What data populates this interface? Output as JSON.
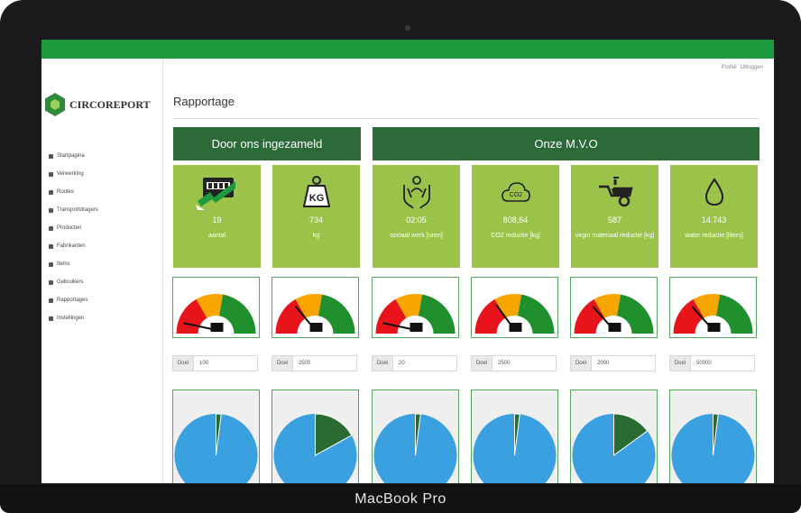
{
  "laptop": {
    "brand": "MacBook Pro"
  },
  "topbar": {
    "links": [
      "Profiel",
      "Uitloggen"
    ]
  },
  "sidebar": {
    "logo_text": "CIRCOREPORT",
    "items": [
      {
        "label": "Startpagina",
        "icon": "home-icon"
      },
      {
        "label": "Verwerking",
        "icon": "grid-icon"
      },
      {
        "label": "Routes",
        "icon": "route-icon"
      },
      {
        "label": "Transportdragers",
        "icon": "truck-icon"
      },
      {
        "label": "Producten",
        "icon": "box-icon"
      },
      {
        "label": "Fabrikanten",
        "icon": "factory-icon"
      },
      {
        "label": "Items",
        "icon": "list-icon"
      },
      {
        "label": "Gebruikers",
        "icon": "users-icon"
      },
      {
        "label": "Rapportages",
        "icon": "report-icon"
      },
      {
        "label": "Instellingen",
        "icon": "settings-icon"
      }
    ]
  },
  "page": {
    "title": "Rapportage"
  },
  "sections": {
    "collected": "Door ons ingezameld",
    "mvo": "Onze M.V.O"
  },
  "tiles": [
    {
      "value": "19",
      "label": "aantal",
      "icon": "container-icon",
      "gauge_pct": 10,
      "goal": "100",
      "pie_pct": 2
    },
    {
      "value": "734",
      "label": "kg",
      "icon": "weight-kg-icon",
      "gauge_pct": 30,
      "goal": "2500",
      "pie_pct": 17
    },
    {
      "value": "02:05",
      "label": "sociaal werk [uren]",
      "icon": "hands-person-icon",
      "gauge_pct": 10,
      "goal": "20",
      "pie_pct": 2
    },
    {
      "value": "808,64",
      "label": "CO2 reductie [kg]",
      "icon": "co2-cloud-icon",
      "gauge_pct": 32,
      "goal": "2500",
      "pie_pct": 2
    },
    {
      "value": "587",
      "label": "virgin materiaal reductie [kg]",
      "icon": "wheelbarrow-icon",
      "gauge_pct": 29,
      "goal": "2000",
      "pie_pct": 15
    },
    {
      "value": "14.743",
      "label": "water reductie [liters]",
      "icon": "water-drop-icon",
      "gauge_pct": 29,
      "goal": "50000",
      "pie_pct": 2
    }
  ],
  "goal_label": "Doel",
  "colors": {
    "topbar": "#1d9a3e",
    "section_header": "#2c6a37",
    "tile": "#9bc34a",
    "gauge_red": "#e8141b",
    "gauge_orange": "#f7a600",
    "gauge_green": "#20902f",
    "pie_blue": "#3aa0e0",
    "pie_green": "#2a6b34"
  }
}
